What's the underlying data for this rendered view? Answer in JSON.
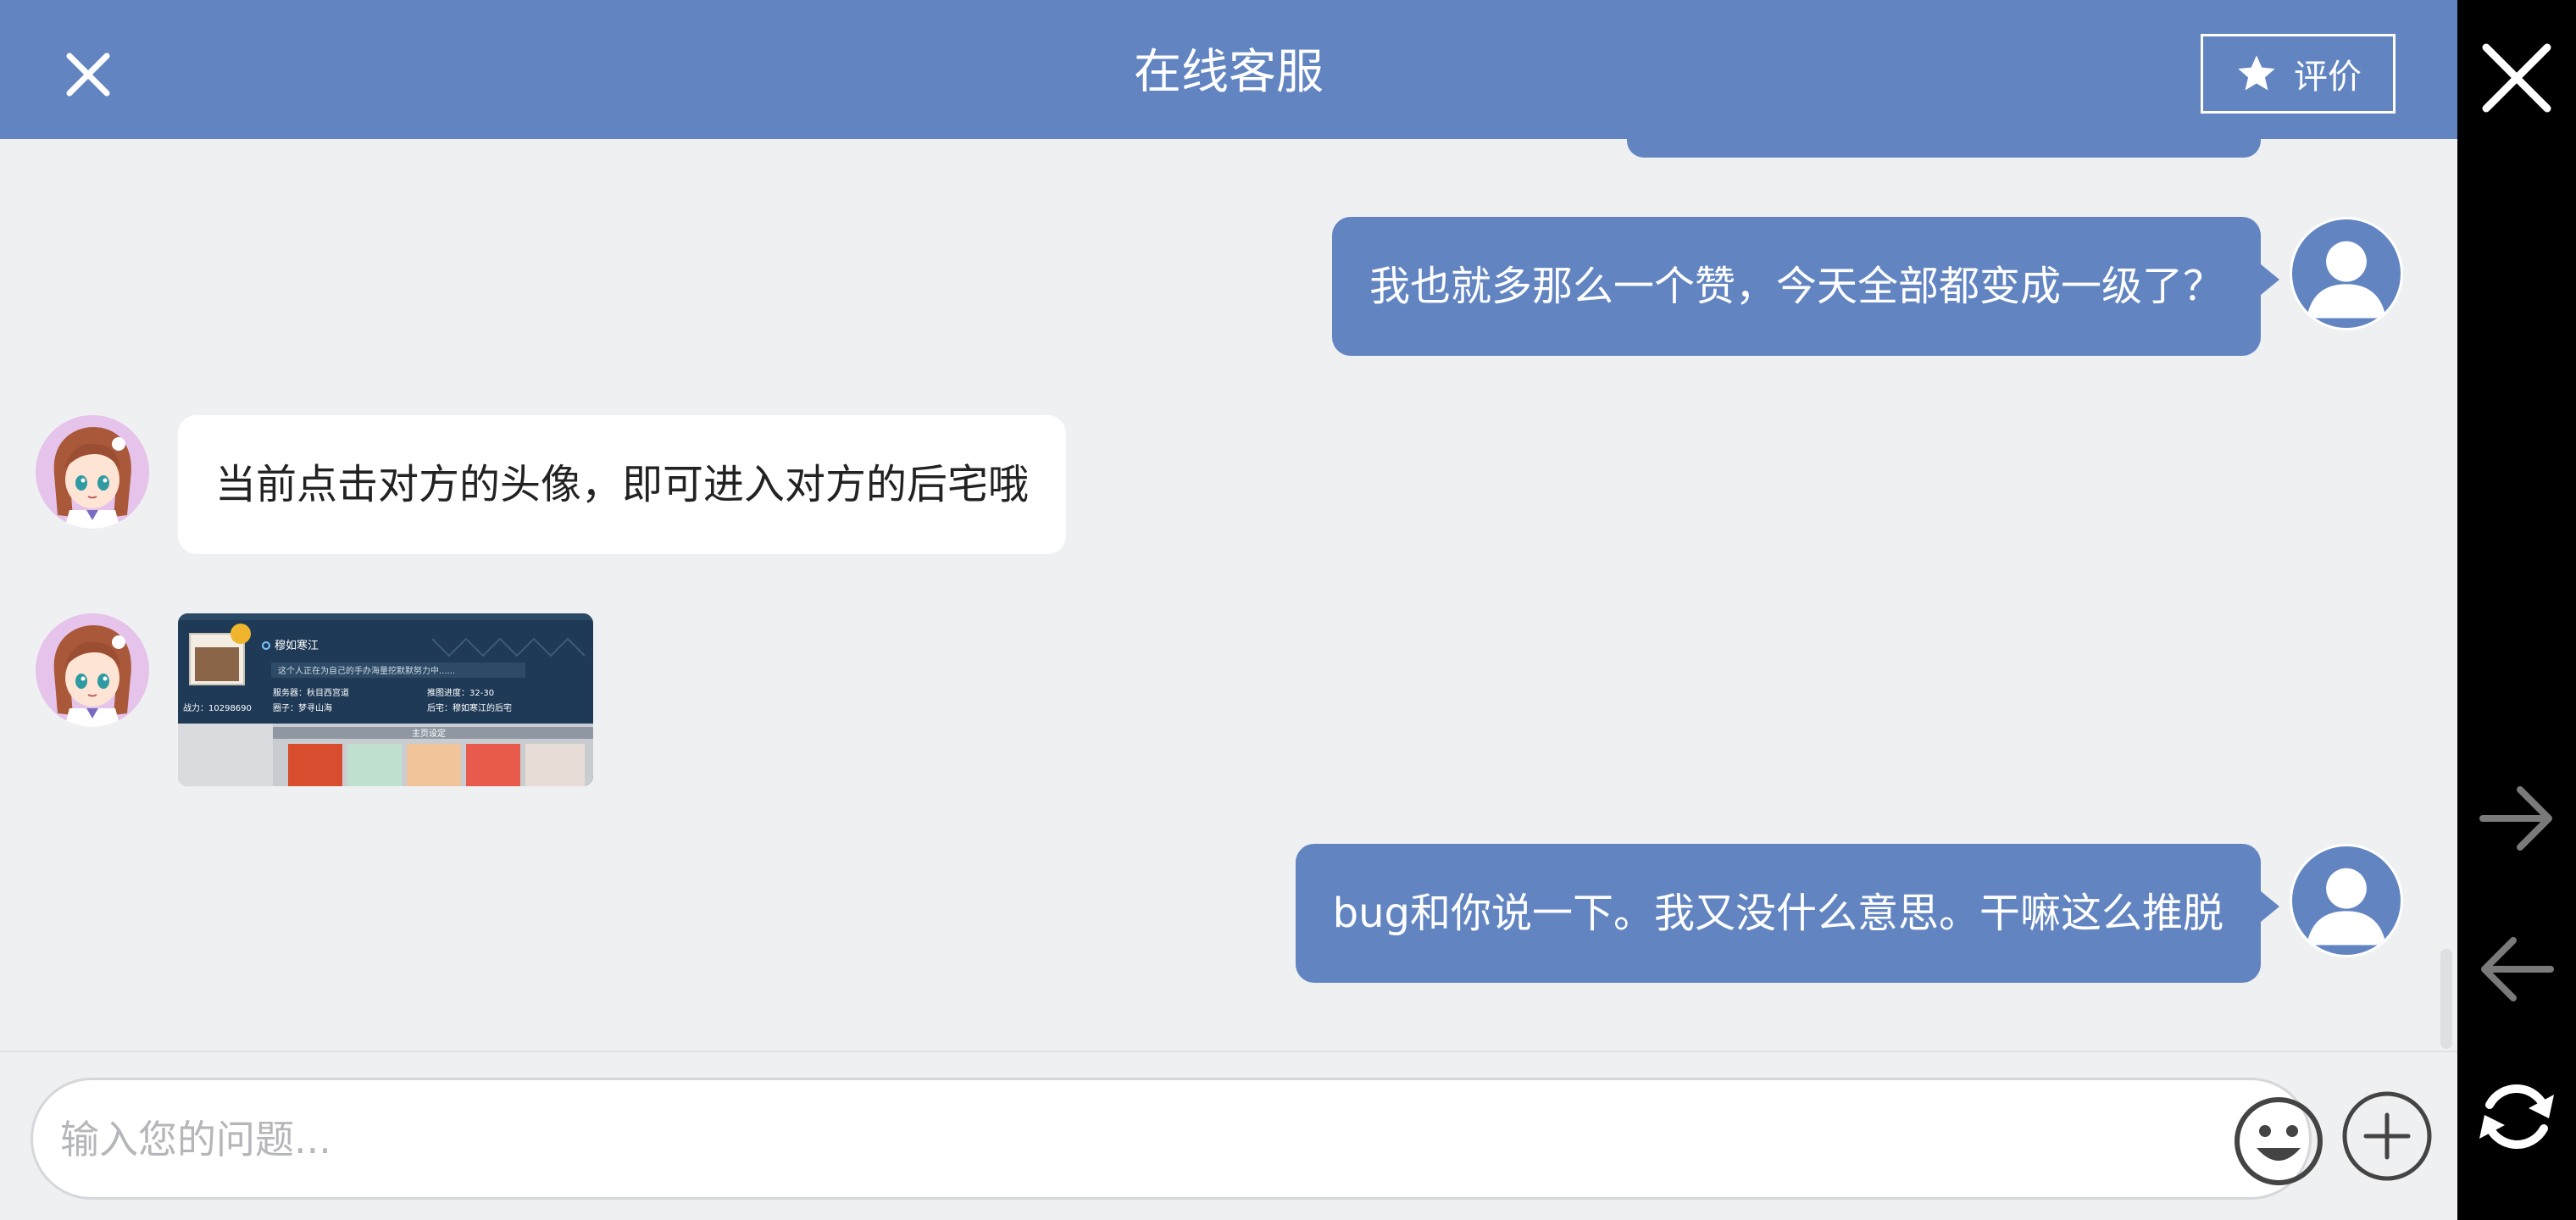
{
  "header": {
    "title": "在线客服",
    "rate_label": "评价",
    "accent_color": "#6285c2"
  },
  "messages": [
    {
      "side": "user",
      "text": "我也就多那么一个赞，今天全部都变成一级了？"
    },
    {
      "side": "agent",
      "text": "当前点击对方的头像，即可进入对方的后宅哦"
    },
    {
      "side": "agent",
      "type": "image",
      "profile": {
        "name": "穆如寒江",
        "signature": "这个人正在为自己的手办海量挖默默努力中......",
        "server_label": "服务器：秋目西宫道",
        "progress_label": "推图进度：32-30",
        "power_label": "战力：10298690",
        "circle_label": "圈子：梦寻山海",
        "home_label": "后宅：穆如寒江的后宅",
        "section_label": "主页设定"
      }
    },
    {
      "side": "user",
      "text": "bug和你说一下。我又没什么意思。干嘛这么推脱"
    }
  ],
  "input": {
    "placeholder": "输入您的问题..."
  },
  "icons": {
    "close": "close-icon",
    "rate": "star-icon",
    "emoji": "smiley-icon",
    "attach": "plus-circle-icon",
    "nav_close": "close-icon",
    "nav_forward": "arrow-right-icon",
    "nav_back": "arrow-left-icon",
    "nav_refresh": "refresh-icon"
  }
}
